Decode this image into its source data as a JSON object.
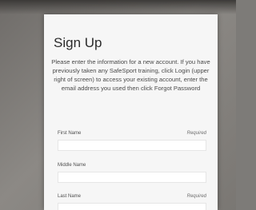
{
  "form": {
    "title": "Sign Up",
    "intro": "Please enter the information for a new account. If you have previously taken any SafeSport training, click Login (upper right of screen) to access your existing account, enter the email address you used then click Forgot Password",
    "fields": [
      {
        "label": "First Name",
        "required_label": "Required",
        "value": ""
      },
      {
        "label": "Middle Name",
        "required_label": "",
        "value": ""
      },
      {
        "label": "Last Name",
        "required_label": "Required",
        "value": ""
      }
    ]
  },
  "colors": {
    "card_background": "#f6f6f6",
    "page_background": "#7d7b78",
    "title_text": "#2b2b2b",
    "body_text": "#4a4a4a"
  }
}
